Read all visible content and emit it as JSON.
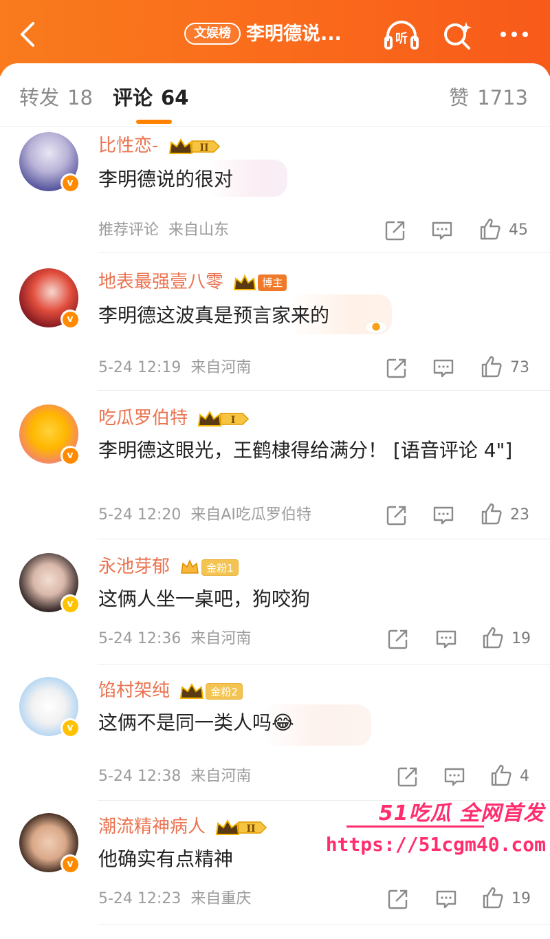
{
  "header": {
    "tag": "文娱榜",
    "title": "李明德说...",
    "listen_icon": "headphones-listen-icon",
    "listen_label": "听",
    "search_icon": "search-sparkle-icon",
    "more_icon": "more-dots-icon"
  },
  "tabs": {
    "repost_label": "转发",
    "repost_count": "18",
    "comment_label": "评论",
    "comment_count": "64",
    "like_label": "赞",
    "like_count": "1713"
  },
  "colors": {
    "brand_orange": "#fa6a1b",
    "username": "#eb7350",
    "watermark": "#ff2d6e"
  },
  "comments": [
    {
      "user": "比性恋-",
      "badge_type": "crown-II",
      "text": "李明德说的很对",
      "time": "推荐评论",
      "location": "来自山东",
      "likes": "45",
      "verified": "orange"
    },
    {
      "user": "地表最强壹八零",
      "badge_type": "crown-blogger",
      "badge_text": "博主",
      "text": "李明德这波真是预言家来的",
      "time": "5-24 12:19",
      "location": "来自河南",
      "likes": "73",
      "verified": "orange"
    },
    {
      "user": "吃瓜罗伯特",
      "badge_type": "crown-I",
      "text": "李明德这眼光，王鹤棣得给满分！ [语音评论 4\"]",
      "time": "5-24 12:20",
      "location": "来自AI吃瓜罗伯特",
      "likes": "23",
      "verified": "orange"
    },
    {
      "user": "永池芽郁",
      "badge_type": "gold-fan",
      "badge_text": "金粉1",
      "text": "这俩人坐一桌吧，狗咬狗",
      "time": "5-24 12:36",
      "location": "来自河南",
      "likes": "19",
      "verified": "yellow"
    },
    {
      "user": "馅村架纯",
      "badge_type": "gold-fan",
      "badge_text": "金粉2",
      "text": "这俩不是同一类人吗😂",
      "time": "5-24 12:38",
      "location": "来自河南",
      "likes": "4",
      "verified": "yellow"
    },
    {
      "user": "潮流精神病人",
      "badge_type": "crown-II",
      "text": "他确实有点精神",
      "time": "5-24 12:23",
      "location": "来自重庆",
      "likes": "19",
      "verified": "orange"
    }
  ],
  "watermark": {
    "brand": "51吃瓜 全网首发",
    "url": "https://51cgm40.com"
  }
}
